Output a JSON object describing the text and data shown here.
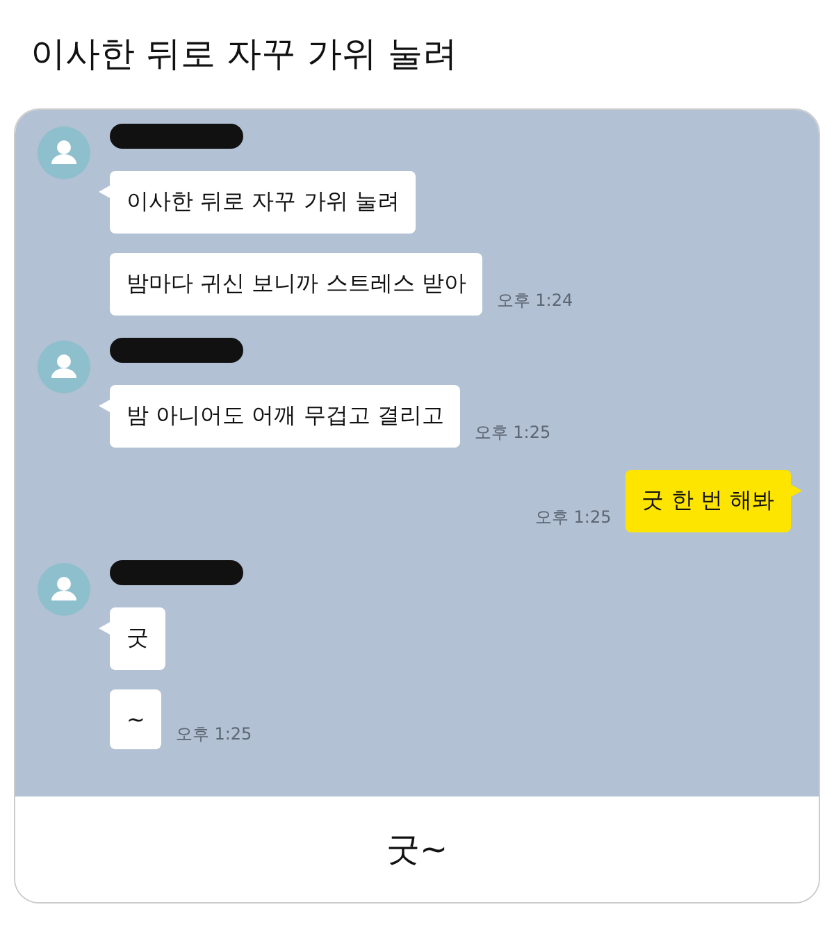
{
  "title": "이사한 뒤로 자꾸 가위 눌려",
  "chat": [
    {
      "kind": "received",
      "messages": [
        {
          "text": "이사한 뒤로 자꾸 가위 눌려"
        },
        {
          "text": "밤마다 귀신 보니까 스트레스 받아",
          "time": "오후 1:24"
        }
      ]
    },
    {
      "kind": "received",
      "messages": [
        {
          "text": "밤 아니어도 어깨 무겁고 결리고",
          "time": "오후 1:25"
        }
      ]
    },
    {
      "kind": "sent",
      "messages": [
        {
          "text": "굿 한 번 해봐",
          "time": "오후 1:25"
        }
      ]
    },
    {
      "kind": "received",
      "messages": [
        {
          "text": "굿"
        },
        {
          "text": "~",
          "time": "오후 1:25"
        }
      ]
    }
  ],
  "caption": "굿~"
}
